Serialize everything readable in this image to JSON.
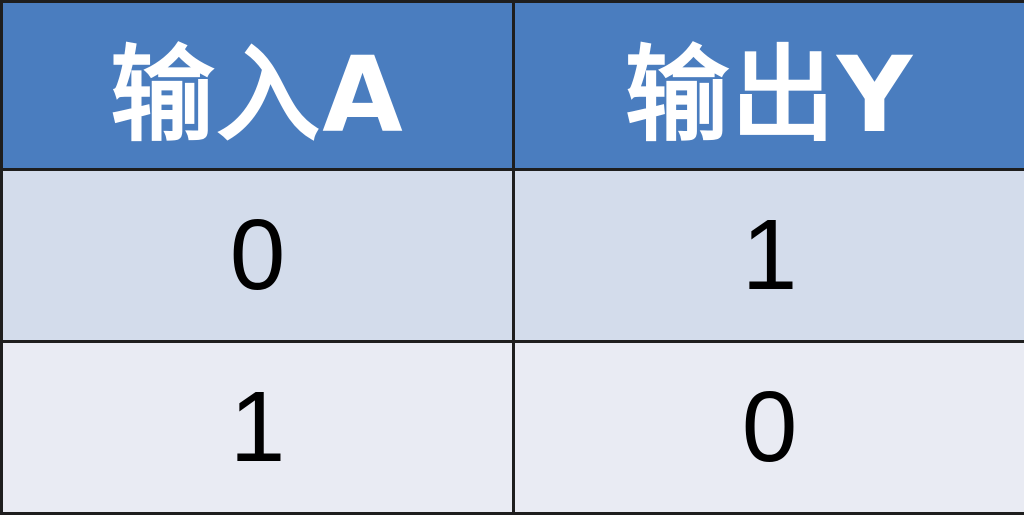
{
  "table": {
    "headers": [
      "输入A",
      "输出Y"
    ],
    "rows": [
      [
        "0",
        "1"
      ],
      [
        "1",
        "0"
      ]
    ]
  },
  "colors": {
    "header_background": "#4a7dbf",
    "header_text": "#ffffff",
    "row_1_background": "#d3dceb",
    "row_2_background": "#e9ebf3",
    "cell_text": "#000000",
    "border": "#1e1e1e"
  }
}
